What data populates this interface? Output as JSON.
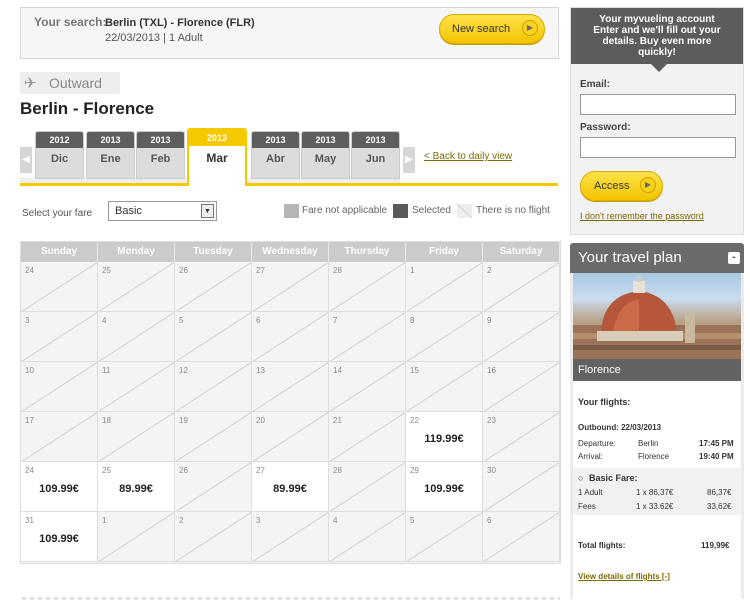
{
  "search": {
    "label": "Your search:",
    "route": "Berlin (TXL) - Florence (FLR)",
    "details": "22/03/2013 | 1 Adult",
    "new_search_label": "New search"
  },
  "outward": {
    "label": "Outward",
    "route_title": "Berlin - Florence"
  },
  "months": [
    {
      "year": "2012",
      "month": "Dic"
    },
    {
      "year": "2013",
      "month": "Ene"
    },
    {
      "year": "2013",
      "month": "Feb"
    },
    {
      "year": "2013",
      "month": "Mar"
    },
    {
      "year": "2013",
      "month": "Abr"
    },
    {
      "year": "2013",
      "month": "May"
    },
    {
      "year": "2013",
      "month": "Jun"
    }
  ],
  "back_link": "< Back to daily view",
  "fare": {
    "label": "Select your fare",
    "selected": "Basic"
  },
  "legend": {
    "not_applicable": "Fare not applicable",
    "selected": "Selected",
    "no_flight": "There is no flight",
    "colors": {
      "not_applicable": "#b5b5b5",
      "selected": "#5a5a5a",
      "no_flight": "#eeeeee"
    }
  },
  "calendar": {
    "weekdays": [
      "Sunday",
      "Monday",
      "Tuesday",
      "Wednesday",
      "Thursday",
      "Friday",
      "Saturday"
    ],
    "weeks": [
      [
        {
          "d": "24"
        },
        {
          "d": "25"
        },
        {
          "d": "26"
        },
        {
          "d": "27"
        },
        {
          "d": "28"
        },
        {
          "d": "1"
        },
        {
          "d": "2"
        }
      ],
      [
        {
          "d": "3"
        },
        {
          "d": "4"
        },
        {
          "d": "5"
        },
        {
          "d": "6"
        },
        {
          "d": "7"
        },
        {
          "d": "8"
        },
        {
          "d": "9"
        }
      ],
      [
        {
          "d": "10"
        },
        {
          "d": "11"
        },
        {
          "d": "12"
        },
        {
          "d": "13"
        },
        {
          "d": "14"
        },
        {
          "d": "15"
        },
        {
          "d": "16"
        }
      ],
      [
        {
          "d": "17"
        },
        {
          "d": "18"
        },
        {
          "d": "19"
        },
        {
          "d": "20"
        },
        {
          "d": "21"
        },
        {
          "d": "22",
          "p": "119.99€"
        },
        {
          "d": "23"
        }
      ],
      [
        {
          "d": "24",
          "p": "109.99€"
        },
        {
          "d": "25",
          "p": "89.99€"
        },
        {
          "d": "26"
        },
        {
          "d": "27",
          "p": "89.99€"
        },
        {
          "d": "28"
        },
        {
          "d": "29",
          "p": "109.99€"
        },
        {
          "d": "30"
        }
      ],
      [
        {
          "d": "31",
          "p": "109.99€"
        },
        {
          "d": "1"
        },
        {
          "d": "2"
        },
        {
          "d": "3"
        },
        {
          "d": "4"
        },
        {
          "d": "5"
        },
        {
          "d": "6"
        }
      ]
    ]
  },
  "account": {
    "header_line1": "Your myvueling account",
    "header_line2": "Enter and we'll fill out your",
    "header_line3": "details. Buy even more",
    "header_line4": "quickly!",
    "email_label": "Email:",
    "password_label": "Password:",
    "access_label": "Access",
    "forgot_label": "I don't remember the password"
  },
  "plan": {
    "title": "Your travel plan",
    "destination": "Florence",
    "flights_label": "Your flights:",
    "outbound": "Outbound: 22/03/2013",
    "departure_label": "Departure:",
    "departure_city": "Berlin",
    "departure_time": "17:45 PM",
    "arrival_label": "Arrival:",
    "arrival_city": "Florence",
    "arrival_time": "19:40 PM",
    "fare_title": "Basic Fare:",
    "adult_label": "1 Adult",
    "adult_calc": "1 x 86,37€",
    "adult_total": "86,37€",
    "fees_label": "Fees",
    "fees_calc": "1 x 33.62€",
    "fees_total": "33,62€",
    "total_label": "Total flights:",
    "total_value": "119,99€",
    "view_details": "View details of flights [-]"
  }
}
